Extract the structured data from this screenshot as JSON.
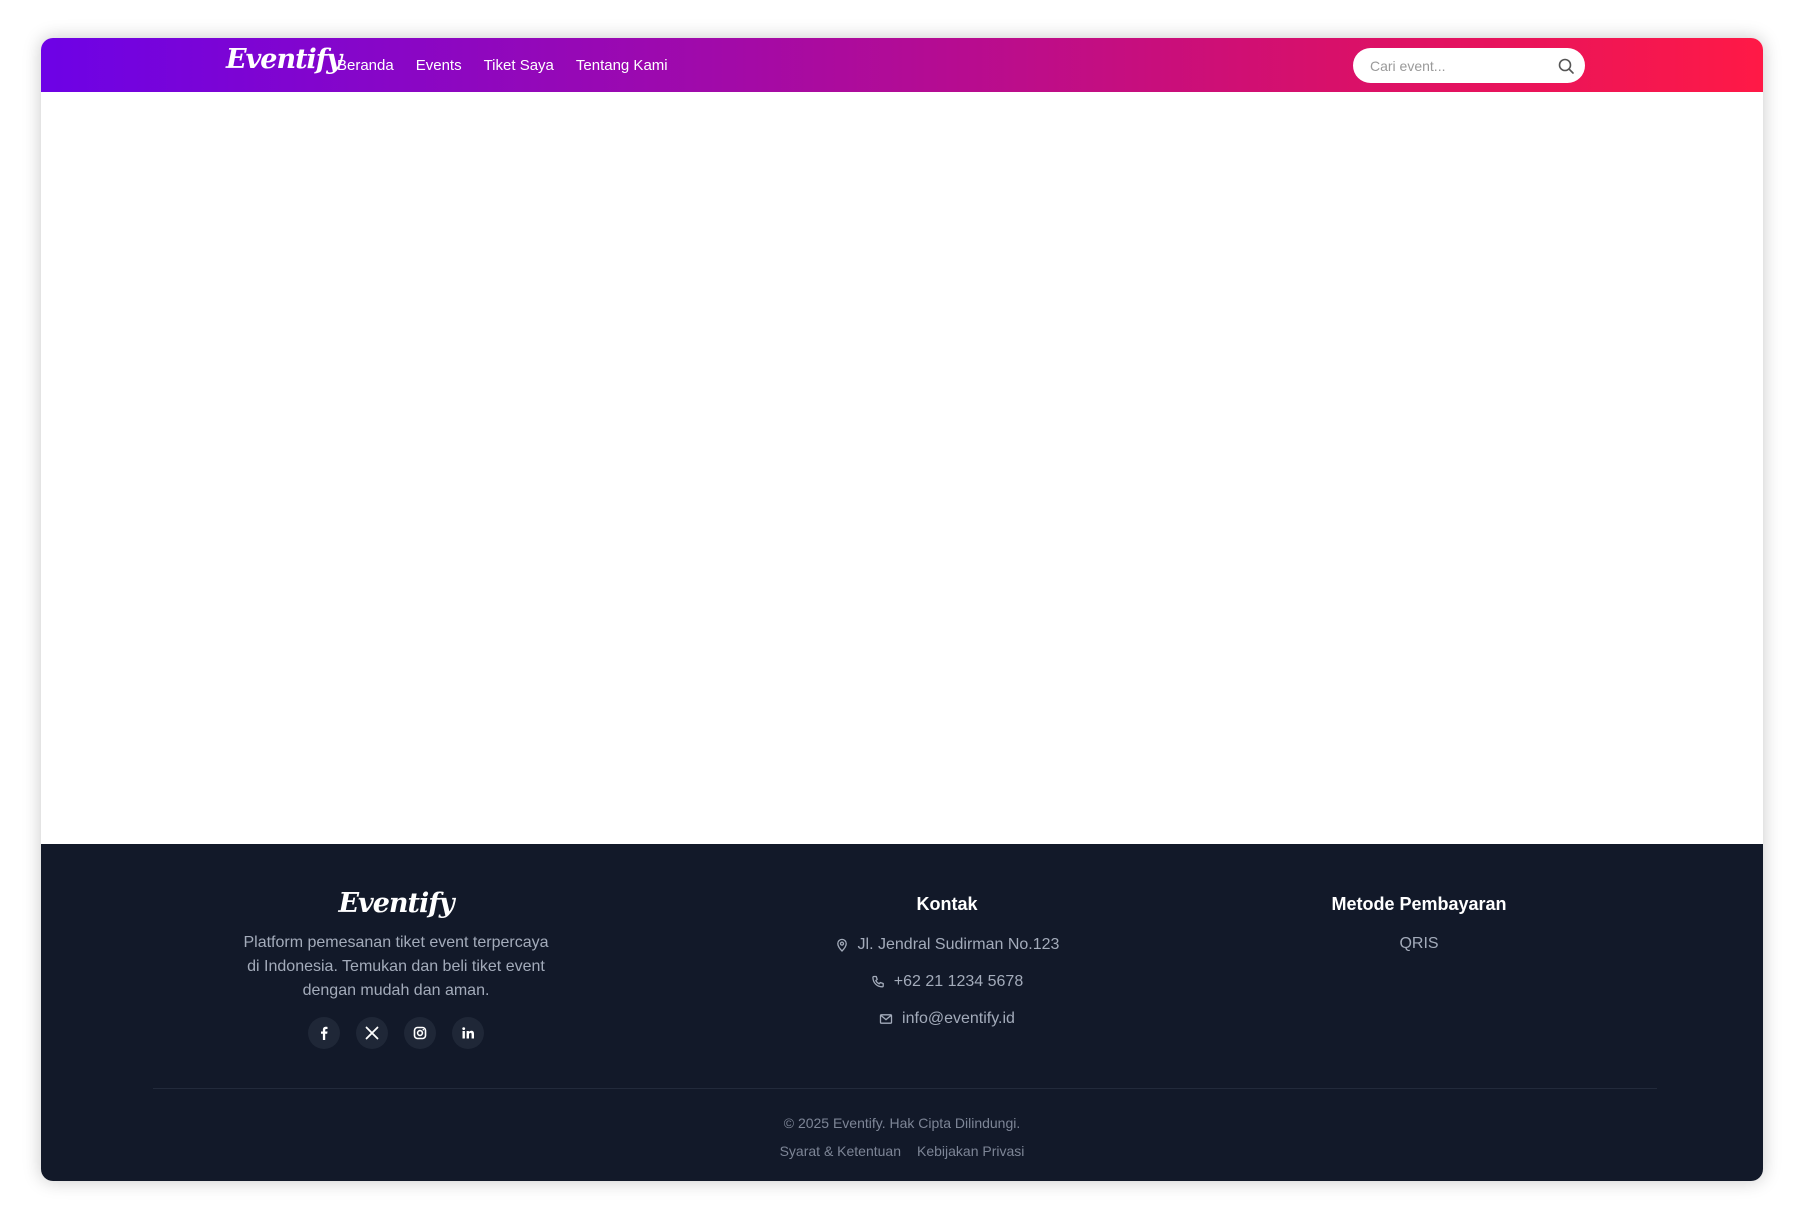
{
  "brand": {
    "name": "Eventify"
  },
  "nav": {
    "links": [
      "Beranda",
      "Events",
      "Tiket Saya",
      "Tentang Kami"
    ]
  },
  "search": {
    "placeholder": "Cari event...",
    "icon": "search-icon"
  },
  "colors": {
    "gradient_start": "#6d02e6",
    "gradient_end": "#ff1946",
    "footer_bg": "#121929"
  },
  "footer": {
    "brand_description": "Platform pemesanan tiket event terpercaya di Indonesia. Temukan dan beli tiket event dengan mudah dan aman.",
    "socials": [
      "facebook-icon",
      "x-icon",
      "instagram-icon",
      "linkedin-icon"
    ],
    "contact": {
      "title": "Kontak",
      "address": "Jl. Jendral Sudirman No.123",
      "phone": "+62 21 1234 5678",
      "email": "info@eventify.id"
    },
    "payment": {
      "title": "Metode Pembayaran",
      "methods": [
        "QRIS"
      ]
    },
    "copyright": "© 2025 Eventify. Hak Cipta Dilindungi.",
    "legal": [
      "Syarat & Ketentuan",
      "Kebijakan Privasi"
    ]
  }
}
